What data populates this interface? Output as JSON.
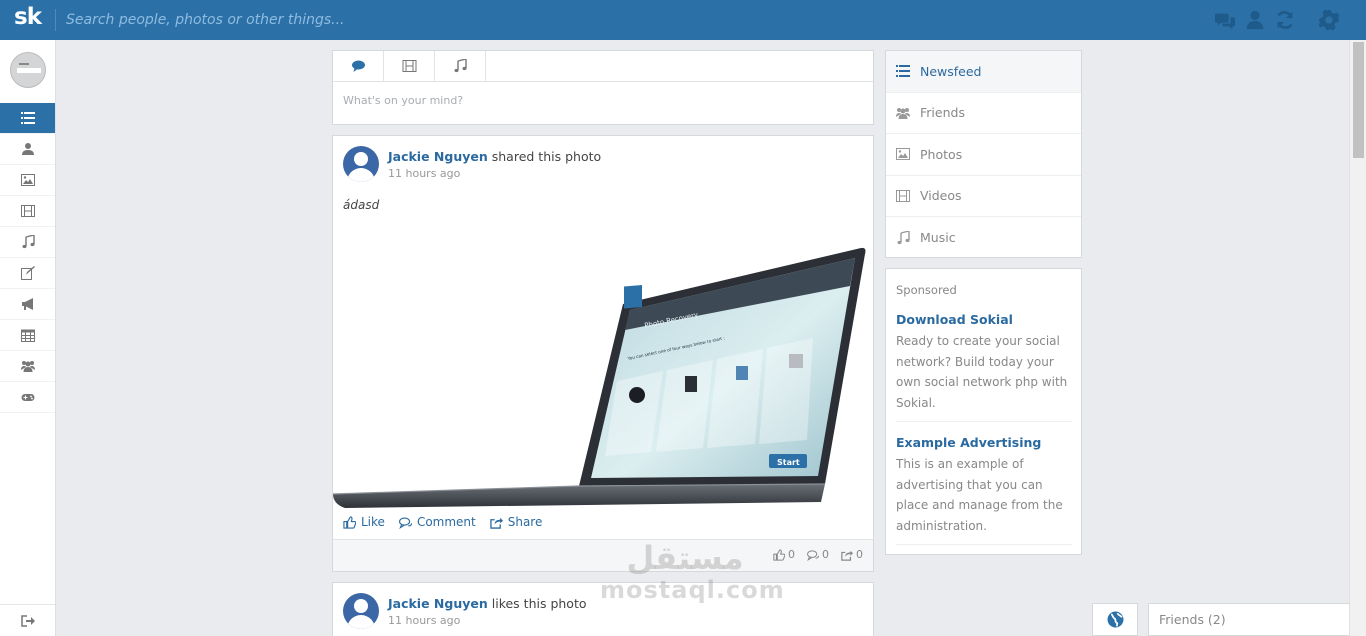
{
  "app": {
    "logo": "sk"
  },
  "search": {
    "placeholder": "Search people, photos or other things..."
  },
  "topbar": {
    "icons": [
      "chat-icon",
      "user-icon",
      "refresh-icon",
      "gear-icon"
    ]
  },
  "sidebar": {
    "items": [
      {
        "name": "newsfeed",
        "icon": "list-icon",
        "active": true
      },
      {
        "name": "profile",
        "icon": "user-icon"
      },
      {
        "name": "photos",
        "icon": "image-icon"
      },
      {
        "name": "videos",
        "icon": "film-icon"
      },
      {
        "name": "music",
        "icon": "music-icon"
      },
      {
        "name": "blog",
        "icon": "edit-icon"
      },
      {
        "name": "ads",
        "icon": "bullhorn-icon"
      },
      {
        "name": "events",
        "icon": "calendar-icon"
      },
      {
        "name": "groups",
        "icon": "users-icon"
      },
      {
        "name": "games",
        "icon": "gamepad-icon"
      }
    ],
    "logout_icon": "sign-out-icon"
  },
  "composer": {
    "tabs": [
      "status",
      "video",
      "music"
    ],
    "placeholder": "What's on your mind?"
  },
  "posts": [
    {
      "author": "Jackie Nguyen",
      "action": "shared this photo",
      "time": "11 hours ago",
      "text": "ádasd",
      "actions": {
        "like": "Like",
        "comment": "Comment",
        "share": "Share"
      },
      "stats": {
        "likes": "0",
        "comments": "0",
        "shares": "0"
      },
      "image_screen": {
        "title": "Photo Recovery",
        "prompt": "You can select one of four ways below to start :",
        "button": "Start"
      }
    },
    {
      "author": "Jackie Nguyen",
      "action": "likes this photo",
      "time": "11 hours ago"
    }
  ],
  "right_menu": {
    "items": [
      {
        "label": "Newsfeed",
        "icon": "list-icon",
        "active": true
      },
      {
        "label": "Friends",
        "icon": "users-icon"
      },
      {
        "label": "Photos",
        "icon": "image-icon"
      },
      {
        "label": "Videos",
        "icon": "film-icon"
      },
      {
        "label": "Music",
        "icon": "music-icon"
      }
    ]
  },
  "sponsored": {
    "title": "Sponsored",
    "ads": [
      {
        "title": "Download Sokial",
        "body": "Ready to create your social network? Build today your own social network php with Sokial."
      },
      {
        "title": "Example Advertising",
        "body": "This is an example of advertising that you can place and manage from the administration."
      }
    ]
  },
  "chat_dock": {
    "globe_icon": "globe-icon",
    "friends_label": "Friends (2)"
  },
  "watermark": {
    "arabic": "مستقل",
    "latin": "mostaql.com"
  },
  "colors": {
    "brand": "#2b71a8",
    "link": "#2b6aa0",
    "background": "#e9ebee"
  }
}
